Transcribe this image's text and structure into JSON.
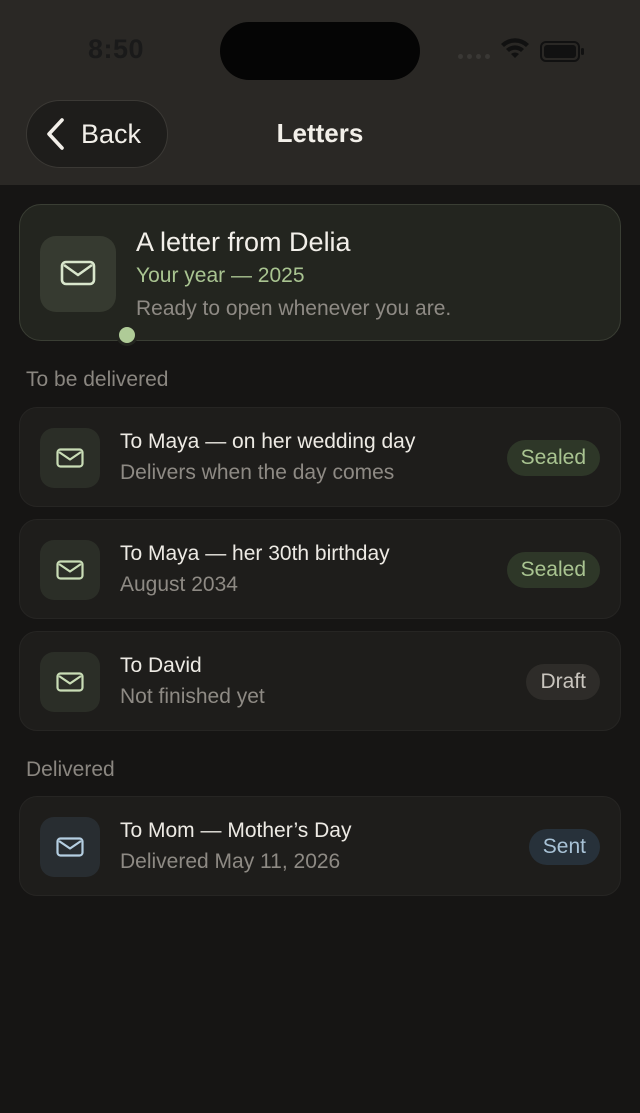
{
  "status_bar": {
    "time": "8:50"
  },
  "nav": {
    "back_label": "Back",
    "title": "Letters"
  },
  "featured": {
    "title": "A letter from Delia",
    "subtitle": "Your year — 2025",
    "description": "Ready to open whenever you are.",
    "icon": "envelope-icon",
    "unread": true
  },
  "sections": {
    "pending_label": "To be delivered",
    "delivered_label": "Delivered"
  },
  "pending": [
    {
      "title": "To Maya — on her wedding day",
      "subtitle": "Delivers when the day comes",
      "badge": "Sealed"
    },
    {
      "title": "To Maya — her 30th birthday",
      "subtitle": "August 2034",
      "badge": "Sealed"
    },
    {
      "title": "To David",
      "subtitle": "Not finished yet",
      "badge": "Draft"
    }
  ],
  "delivered": [
    {
      "title": "To Mom — Mother’s Day",
      "subtitle": "Delivered May 11, 2026",
      "badge": "Sent"
    }
  ],
  "colors": {
    "accent_green": "#A9C491",
    "accent_blue": "#A8C2D6",
    "background": "#161514",
    "card": "#1E1D1B"
  }
}
